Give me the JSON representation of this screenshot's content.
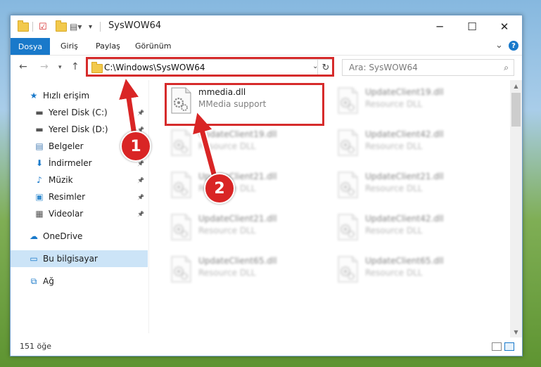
{
  "window": {
    "title": "SysWOW64",
    "minimize": "─",
    "maximize": "☐",
    "close": "✕"
  },
  "ribbon": {
    "tabs": [
      "Dosya",
      "Giriş",
      "Paylaş",
      "Görünüm"
    ],
    "collapse_icon": "⌄",
    "help_icon": "?"
  },
  "address": {
    "path": "C:\\Windows\\SysWOW64",
    "search_placeholder": "Ara: SysWOW64"
  },
  "nav": {
    "items": [
      {
        "label": "Hızlı erişim",
        "icon": "star-icon"
      },
      {
        "label": "Yerel Disk (C:)",
        "icon": "drive-icon",
        "pinned": true
      },
      {
        "label": "Yerel Disk (D:)",
        "icon": "drive-icon",
        "pinned": true
      },
      {
        "label": "Belgeler",
        "icon": "documents-icon",
        "pinned": true
      },
      {
        "label": "İndirmeler",
        "icon": "download-icon",
        "pinned": true
      },
      {
        "label": "Müzik",
        "icon": "music-icon",
        "pinned": true
      },
      {
        "label": "Resimler",
        "icon": "pictures-icon",
        "pinned": true
      },
      {
        "label": "Videolar",
        "icon": "videos-icon",
        "pinned": true
      },
      {
        "label": "OneDrive",
        "icon": "cloud-icon"
      },
      {
        "label": "Bu bilgisayar",
        "icon": "computer-icon",
        "selected": true
      },
      {
        "label": "Ağ",
        "icon": "network-icon"
      }
    ]
  },
  "files": [
    {
      "name": "mmedia.dll",
      "desc": "MMedia support",
      "highlighted": true
    },
    {
      "name": "UpdateClient19.dll",
      "desc": "Resource DLL"
    },
    {
      "name": "UpdateClient19.dll",
      "desc": "Resource DLL"
    },
    {
      "name": "UpdateClient42.dll",
      "desc": "Resource DLL"
    },
    {
      "name": "UpdateClient21.dll",
      "desc": "Resource DLL"
    },
    {
      "name": "UpdateClient21.dll",
      "desc": "Resource DLL"
    },
    {
      "name": "UpdateClient21.dll",
      "desc": "Resource DLL"
    },
    {
      "name": "UpdateClient42.dll",
      "desc": "Resource DLL"
    },
    {
      "name": "UpdateClient65.dll",
      "desc": "Resource DLL"
    },
    {
      "name": "UpdateClient65.dll",
      "desc": "Resource DLL"
    }
  ],
  "status": {
    "count": "151 öğe"
  },
  "annotations": {
    "step1": "1",
    "step2": "2",
    "color": "#d92525"
  }
}
